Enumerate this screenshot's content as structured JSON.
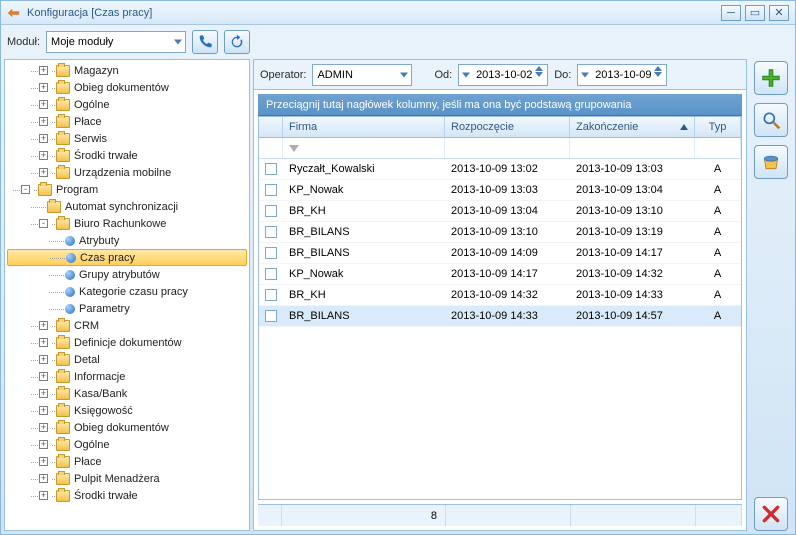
{
  "window": {
    "title": "Konfiguracja [Czas pracy]"
  },
  "toolbar": {
    "modul_label": "Moduł:",
    "modul_value": "Moje moduły",
    "operator_label": "Operator:",
    "operator_value": "ADMIN",
    "od_label": "Od:",
    "od_value": "2013-10-02",
    "do_label": "Do:",
    "do_value": "2013-10-09"
  },
  "tree": [
    {
      "level": 1,
      "expander": "+",
      "icon": "folder",
      "label": "Magazyn"
    },
    {
      "level": 1,
      "expander": "+",
      "icon": "folder",
      "label": "Obieg dokumentów"
    },
    {
      "level": 1,
      "expander": "+",
      "icon": "folder",
      "label": "Ogólne"
    },
    {
      "level": 1,
      "expander": "+",
      "icon": "folder",
      "label": "Płace"
    },
    {
      "level": 1,
      "expander": "+",
      "icon": "folder",
      "label": "Serwis"
    },
    {
      "level": 1,
      "expander": "+",
      "icon": "folder",
      "label": "Środki trwałe"
    },
    {
      "level": 1,
      "expander": "+",
      "icon": "folder",
      "label": "Urządzenia mobilne"
    },
    {
      "level": 0,
      "expander": "-",
      "icon": "folder",
      "label": "Program"
    },
    {
      "level": 1,
      "expander": "",
      "icon": "folder",
      "label": "Automat synchronizacji"
    },
    {
      "level": 1,
      "expander": "-",
      "icon": "folder",
      "label": "Biuro Rachunkowe"
    },
    {
      "level": 2,
      "expander": "",
      "icon": "ball",
      "label": "Atrybuty"
    },
    {
      "level": 2,
      "expander": "",
      "icon": "ball",
      "label": "Czas pracy",
      "selected": true
    },
    {
      "level": 2,
      "expander": "",
      "icon": "ball",
      "label": "Grupy atrybutów"
    },
    {
      "level": 2,
      "expander": "",
      "icon": "ball",
      "label": "Kategorie czasu pracy"
    },
    {
      "level": 2,
      "expander": "",
      "icon": "ball",
      "label": "Parametry"
    },
    {
      "level": 1,
      "expander": "+",
      "icon": "folder",
      "label": "CRM"
    },
    {
      "level": 1,
      "expander": "+",
      "icon": "folder",
      "label": "Definicje dokumentów"
    },
    {
      "level": 1,
      "expander": "+",
      "icon": "folder",
      "label": "Detal"
    },
    {
      "level": 1,
      "expander": "+",
      "icon": "folder",
      "label": "Informacje"
    },
    {
      "level": 1,
      "expander": "+",
      "icon": "folder",
      "label": "Kasa/Bank"
    },
    {
      "level": 1,
      "expander": "+",
      "icon": "folder",
      "label": "Księgowość"
    },
    {
      "level": 1,
      "expander": "+",
      "icon": "folder",
      "label": "Obieg dokumentów"
    },
    {
      "level": 1,
      "expander": "+",
      "icon": "folder",
      "label": "Ogólne"
    },
    {
      "level": 1,
      "expander": "+",
      "icon": "folder",
      "label": "Płace"
    },
    {
      "level": 1,
      "expander": "+",
      "icon": "folder",
      "label": "Pulpit Menadżera"
    },
    {
      "level": 1,
      "expander": "+",
      "icon": "folder",
      "label": "Środki trwałe"
    }
  ],
  "grid": {
    "grouphint": "Przeciągnij tutaj nagłówek kolumny, jeśli ma ona być podstawą grupowania",
    "columns": {
      "firma": "Firma",
      "rozpoczecie": "Rozpoczęcie",
      "zakonczenie": "Zakończenie",
      "typ": "Typ"
    },
    "rows": [
      {
        "firma": "Ryczałt_Kowalski",
        "r": "2013-10-09 13:02",
        "z": "2013-10-09 13:03",
        "t": "A"
      },
      {
        "firma": "KP_Nowak",
        "r": "2013-10-09 13:03",
        "z": "2013-10-09 13:04",
        "t": "A"
      },
      {
        "firma": "BR_KH",
        "r": "2013-10-09 13:04",
        "z": "2013-10-09 13:10",
        "t": "A"
      },
      {
        "firma": "BR_BILANS",
        "r": "2013-10-09 13:10",
        "z": "2013-10-09 13:19",
        "t": "A"
      },
      {
        "firma": "BR_BILANS",
        "r": "2013-10-09 14:09",
        "z": "2013-10-09 14:17",
        "t": "A"
      },
      {
        "firma": "KP_Nowak",
        "r": "2013-10-09 14:17",
        "z": "2013-10-09 14:32",
        "t": "A"
      },
      {
        "firma": "BR_KH",
        "r": "2013-10-09 14:32",
        "z": "2013-10-09 14:33",
        "t": "A"
      },
      {
        "firma": "BR_BILANS",
        "r": "2013-10-09 14:33",
        "z": "2013-10-09 14:57",
        "t": "A",
        "selected": true
      }
    ],
    "footer_count": "8"
  }
}
